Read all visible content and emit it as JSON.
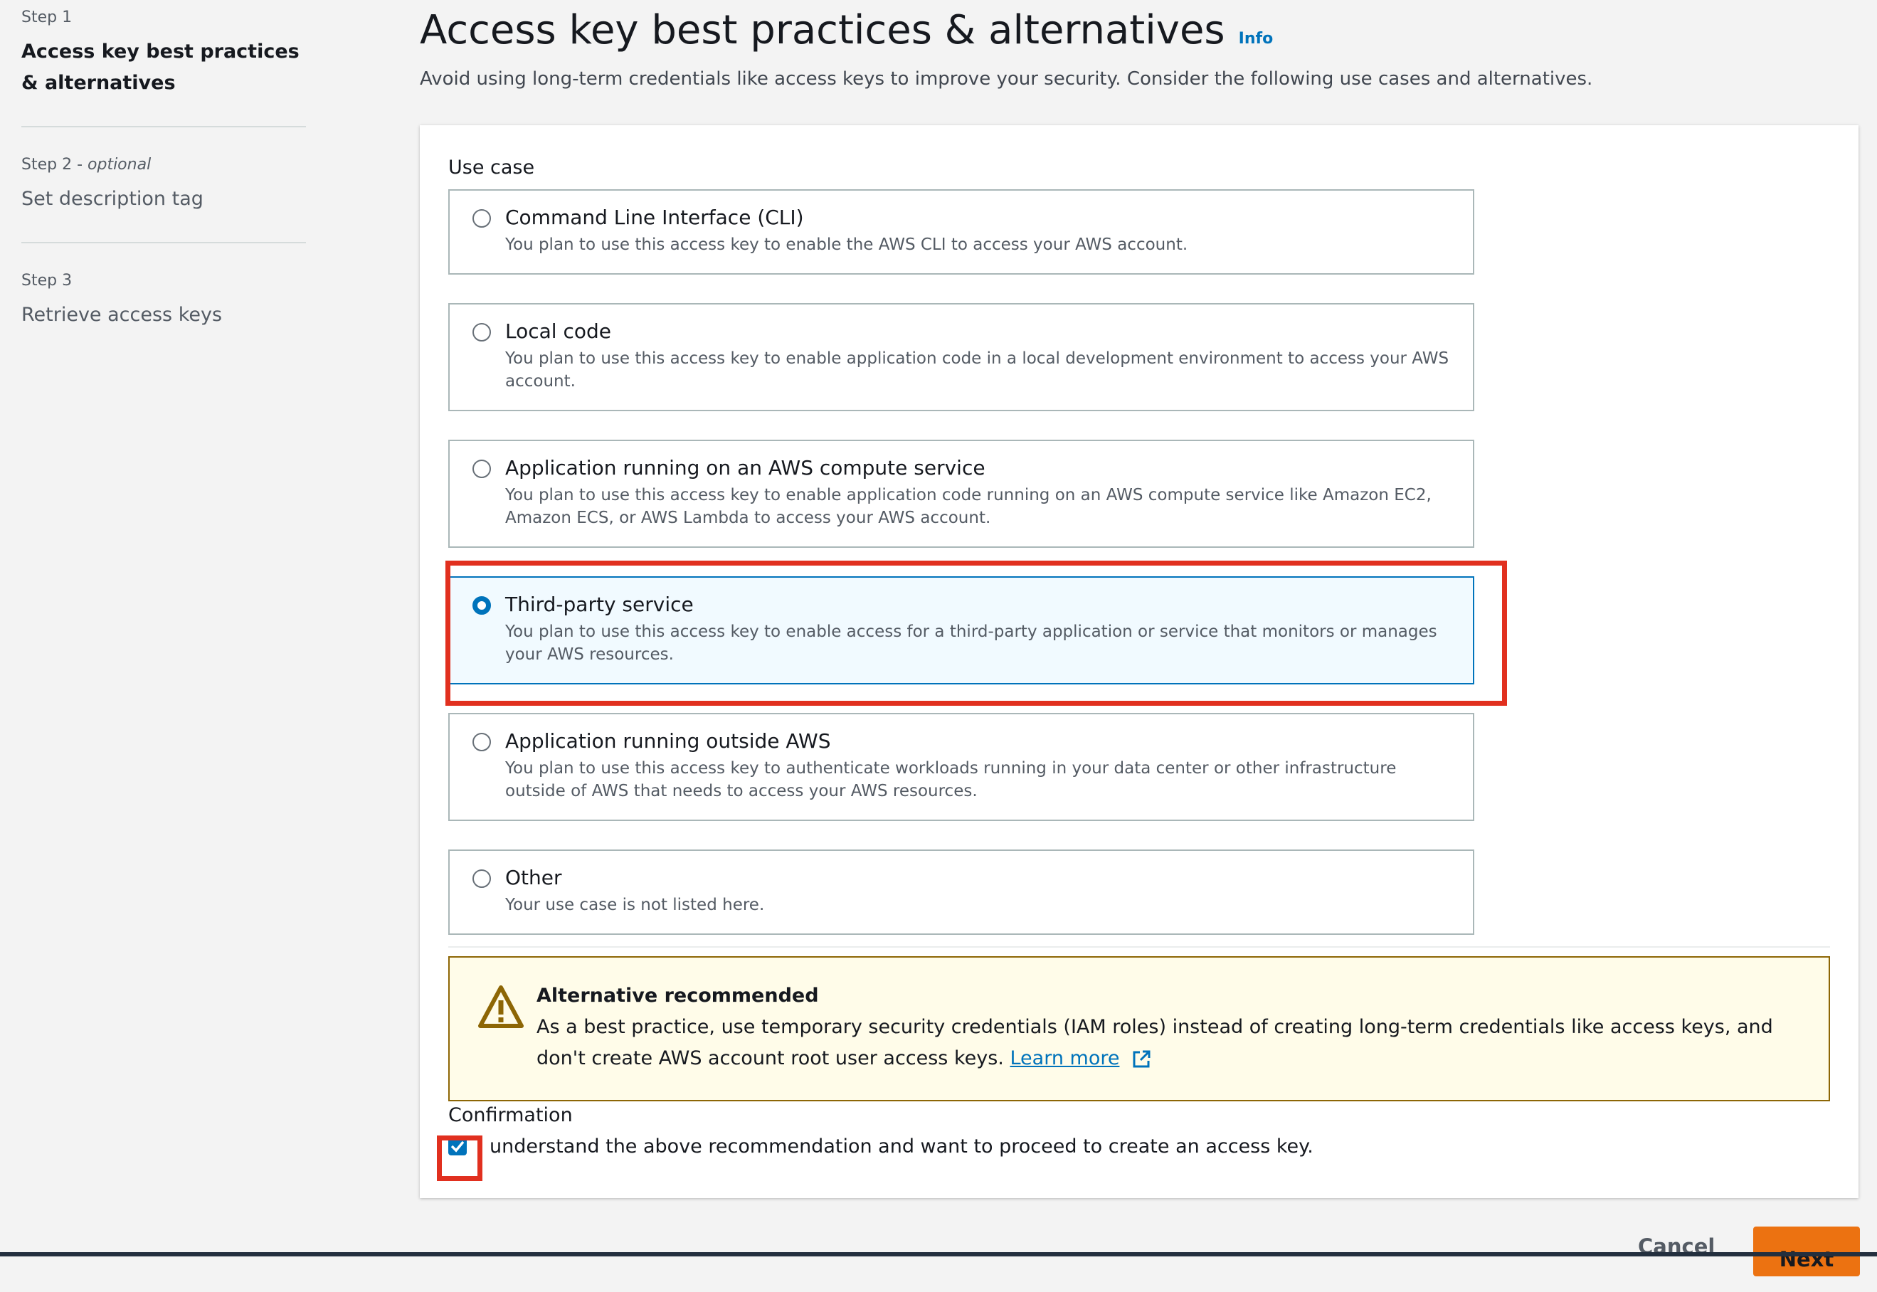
{
  "sidebar": {
    "steps": [
      {
        "number": "Step 1",
        "optional": "",
        "title": "Access key best practices & alternatives"
      },
      {
        "number": "Step 2 - ",
        "optional": "optional",
        "title": "Set description tag"
      },
      {
        "number": "Step 3",
        "optional": "",
        "title": "Retrieve access keys"
      }
    ]
  },
  "header": {
    "title": "Access key best practices & alternatives",
    "info": "Info",
    "subtitle": "Avoid using long-term credentials like access keys to improve your security. Consider the following use cases and alternatives."
  },
  "use_case": {
    "label": "Use case",
    "selected": "Third-party service",
    "options": [
      {
        "title": "Command Line Interface (CLI)",
        "desc": "You plan to use this access key to enable the AWS CLI to access your AWS account."
      },
      {
        "title": "Local code",
        "desc": "You plan to use this access key to enable application code in a local development environment to access your AWS account."
      },
      {
        "title": "Application running on an AWS compute service",
        "desc": "You plan to use this access key to enable application code running on an AWS compute service like Amazon EC2, Amazon ECS, or AWS Lambda to access your AWS account."
      },
      {
        "title": "Third-party service",
        "desc": "You plan to use this access key to enable access for a third-party application or service that monitors or manages your AWS resources."
      },
      {
        "title": "Application running outside AWS",
        "desc": "You plan to use this access key to authenticate workloads running in your data center or other infrastructure outside of AWS that needs to access your AWS resources."
      },
      {
        "title": "Other",
        "desc": "Your use case is not listed here."
      }
    ]
  },
  "alert": {
    "title": "Alternative recommended",
    "body": "As a best practice, use temporary security credentials (IAM roles) instead of creating long-term credentials like access keys, and don't create AWS account root user access keys.",
    "link": "Learn more",
    "icon": "warning-icon"
  },
  "confirmation": {
    "label": "Confirmation",
    "checked": true,
    "text": "understand the above recommendation and want to proceed to create an access key."
  },
  "footer": {
    "cancel": "Cancel",
    "next": "Next"
  },
  "colors": {
    "accent": "#0073bb",
    "highlight": "#e1301f",
    "primary_button": "#ec7211",
    "warning_bg": "#fffce9"
  }
}
